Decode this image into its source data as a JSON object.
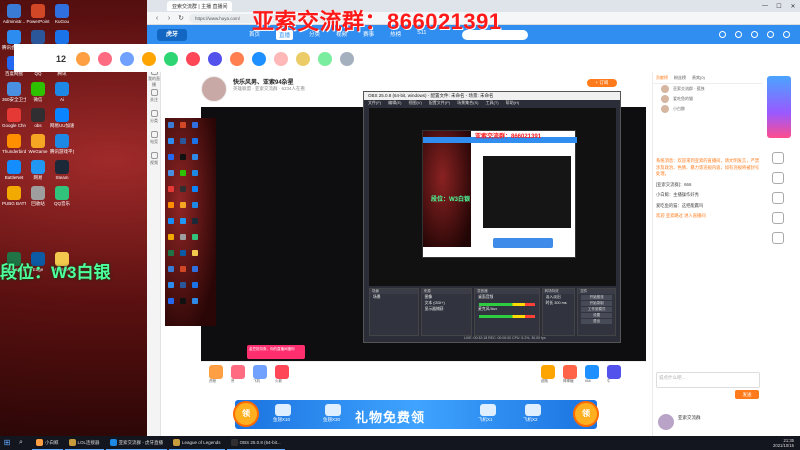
{
  "overlay": {
    "group_text": "亚索交流群：866021391",
    "rank_text": "段位：W3白银"
  },
  "desktop": {
    "icons": [
      {
        "label": "Administr...",
        "color": "#3a7bd5"
      },
      {
        "label": "PowerPoint",
        "color": "#d24726"
      },
      {
        "label": "KuGou",
        "color": "#2f6fe0"
      },
      {
        "label": "腾讯会议 4.0",
        "color": "#2d8cf0"
      },
      {
        "label": "Word 2019",
        "color": "#2b579a"
      },
      {
        "label": "KaDou",
        "color": "#1a73e8"
      },
      {
        "label": "百度网盘",
        "color": "#2468f2"
      },
      {
        "label": "QQ",
        "color": "#111111"
      },
      {
        "label": "腾讯",
        "color": "#2e8ae6"
      },
      {
        "label": "360安全卫士",
        "color": "#4a90e2"
      },
      {
        "label": "微信",
        "color": "#2dc100"
      },
      {
        "label": "Ai",
        "color": "#1e88e5"
      },
      {
        "label": "Google Chrome",
        "color": "#e53935"
      },
      {
        "label": "obs",
        "color": "#302e31"
      },
      {
        "label": "网易UU加速器",
        "color": "#0a84ff"
      },
      {
        "label": "Thunderbird",
        "color": "#ff8f00"
      },
      {
        "label": "WeGame",
        "color": "#f5a623"
      },
      {
        "label": "腾讯游戏平台",
        "color": "#1e88e5"
      },
      {
        "label": "BattleNet",
        "color": "#148eff"
      },
      {
        "label": "网易",
        "color": "#2196f3"
      },
      {
        "label": "Steam",
        "color": "#1b2838"
      },
      {
        "label": "PUBG BATTLEGR...",
        "color": "#f2a900"
      },
      {
        "label": "回收站",
        "color": "#9e9e9e"
      },
      {
        "label": "QQ音乐",
        "color": "#31c27c"
      },
      {
        "label": "Excel 2019",
        "color": "#217346"
      },
      {
        "label": "Edge",
        "color": "#0c59a4"
      },
      {
        "label": "MS Store",
        "color": "#f2c94c"
      }
    ]
  },
  "browser": {
    "tab_title": "亚索交流群 | 主播 直播间",
    "url": "https://www.huya.com/",
    "min": "—",
    "max": "☐",
    "close": "✕",
    "site_logo": "虎牙",
    "nav": [
      {
        "label": "首页",
        "active": false
      },
      {
        "label": "直播",
        "active": true
      },
      {
        "label": "分类",
        "active": false
      },
      {
        "label": "视频",
        "active": false
      },
      {
        "label": "赛事",
        "active": false
      },
      {
        "label": "热榜",
        "active": false
      },
      {
        "label": "S11",
        "active": false
      }
    ]
  },
  "siderail": [
    {
      "label": "首页"
    },
    {
      "label": "我的直播"
    },
    {
      "label": "关注"
    },
    {
      "label": "分类"
    },
    {
      "label": "电竞"
    },
    {
      "label": "视频"
    }
  ],
  "room": {
    "rank_number": "12",
    "title": "快乐风男、亚索94杂星",
    "subtitle": "英雄联盟 · 亚索交流群 · 6234人在看",
    "subscribe": "+ 订阅"
  },
  "obs": {
    "window_title": "OBS 25.0.8 (64-bit, windows) - 配置文件: 未命名 - 场景: 未命名",
    "menu": [
      "文件(F)",
      "编辑(E)",
      "视图(V)",
      "配置文件(P)",
      "场景集合(S)",
      "工具(T)",
      "帮助(H)"
    ],
    "preview_group": "亚索交流群：866021391",
    "preview_rank": "段位：W3白银",
    "docks": {
      "scenes": "场景",
      "sources": "来源",
      "mixer": "混音器",
      "transitions": "转场特效",
      "controls": "控件"
    },
    "scene_items": [
      "场景"
    ],
    "source_items": [
      "图像",
      "文本 (GDI+)",
      "显示器捕获"
    ],
    "mixer_items": [
      "桌面音频",
      "麦克风/Aux"
    ],
    "transition_items": [
      "淡入淡出",
      "时长 300 ms"
    ],
    "control_buttons": [
      "开始推流",
      "开始录制",
      "工作室模式",
      "设置",
      "退出"
    ],
    "status": "LIVE: 00:32:18  REC: 00:00:00  CPU: 5.2%, 30.00 fps"
  },
  "gifts": {
    "promo": "金豆抵扣券，你的直播间福利",
    "items": [
      {
        "label": "虎粮",
        "color": "#ff9f43"
      },
      {
        "label": "赞",
        "color": "#ff6b81"
      },
      {
        "label": "飞机",
        "color": "#70a1ff"
      },
      {
        "label": "火箭",
        "color": "#ff4757"
      },
      {
        "label": "超跑",
        "color": "#ffa502"
      },
      {
        "label": "棒棒糖",
        "color": "#ff6348"
      },
      {
        "label": "666",
        "color": "#1e90ff"
      },
      {
        "label": "牛",
        "color": "#5352ed"
      }
    ]
  },
  "banner": {
    "title": "礼物免费领",
    "coin_label": "领",
    "rewards": [
      "鱼翅X10",
      "鱼翅X30",
      "飞机X1",
      "飞机X2"
    ]
  },
  "chat": {
    "tabs": [
      {
        "label": "贡献榜",
        "active": true
      },
      {
        "label": "粉丝榜",
        "active": false
      },
      {
        "label": "贵宾(0)",
        "active": false
      }
    ],
    "ranking": [
      {
        "name": "亚索交流群 · 孤独"
      },
      {
        "name": "爱吃鱼的猫"
      },
      {
        "name": "小白鲸"
      }
    ],
    "messages": [
      {
        "text": "系统消息：欢迎来到亚索的直播间，请文明发言，严禁涉及政治、色情、暴力等违规内容，如有违规将被封号处理。",
        "sys": true
      },
      {
        "text": "[亚索交流群]：666",
        "sys": false
      },
      {
        "text": "小白鲸：主播操作好秀",
        "sys": false
      },
      {
        "text": "爱吃鱼的猫：这把能赢吗",
        "sys": false
      },
      {
        "text": "欢迎 亚索路过 进入直播间",
        "sys": true
      }
    ],
    "input_placeholder": "说点什么吧…",
    "send": "发送",
    "user": "亚索交流群"
  },
  "taskbar": {
    "apps": [
      {
        "label": "小白鲸",
        "color": "#ff9f43"
      },
      {
        "label": "LOL连接器",
        "color": "#c89b3c"
      },
      {
        "label": "亚索交流群 - 虎牙直播",
        "color": "#1e88e5"
      },
      {
        "label": "League of Legends",
        "color": "#c89b3c"
      },
      {
        "label": "OBS 25.0.8 (64-bit...",
        "color": "#302e31"
      }
    ],
    "time": "21:35",
    "date": "2021/10/15"
  },
  "colors": {
    "accent": "#ff7a1a",
    "site_blue": "#2f8ef0",
    "overlay_red": "#ff1a1a",
    "overlay_green": "#4dff9a"
  }
}
